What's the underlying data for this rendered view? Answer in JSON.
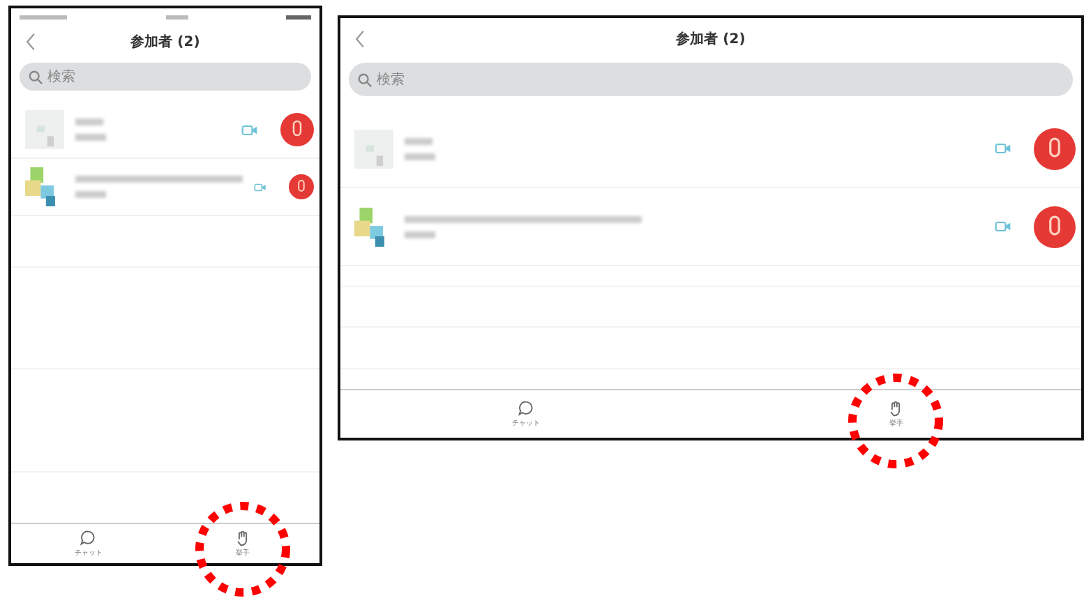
{
  "screens": [
    {
      "kind": "phone",
      "title": "参加者 (2)",
      "search": {
        "placeholder": "検索"
      },
      "participants": [
        {
          "kind": "plain"
        },
        {
          "kind": "tiles"
        }
      ],
      "tabs": [
        {
          "label": "チャット",
          "highlighted": false
        },
        {
          "label": "挙手",
          "highlighted": true
        }
      ]
    },
    {
      "kind": "tablet",
      "title": "参加者 (2)",
      "search": {
        "placeholder": "検索"
      },
      "participants": [
        {
          "kind": "plain"
        },
        {
          "kind": "tiles"
        }
      ],
      "tabs": [
        {
          "label": "チャット",
          "highlighted": false
        },
        {
          "label": "挙手",
          "highlighted": true
        }
      ]
    }
  ]
}
